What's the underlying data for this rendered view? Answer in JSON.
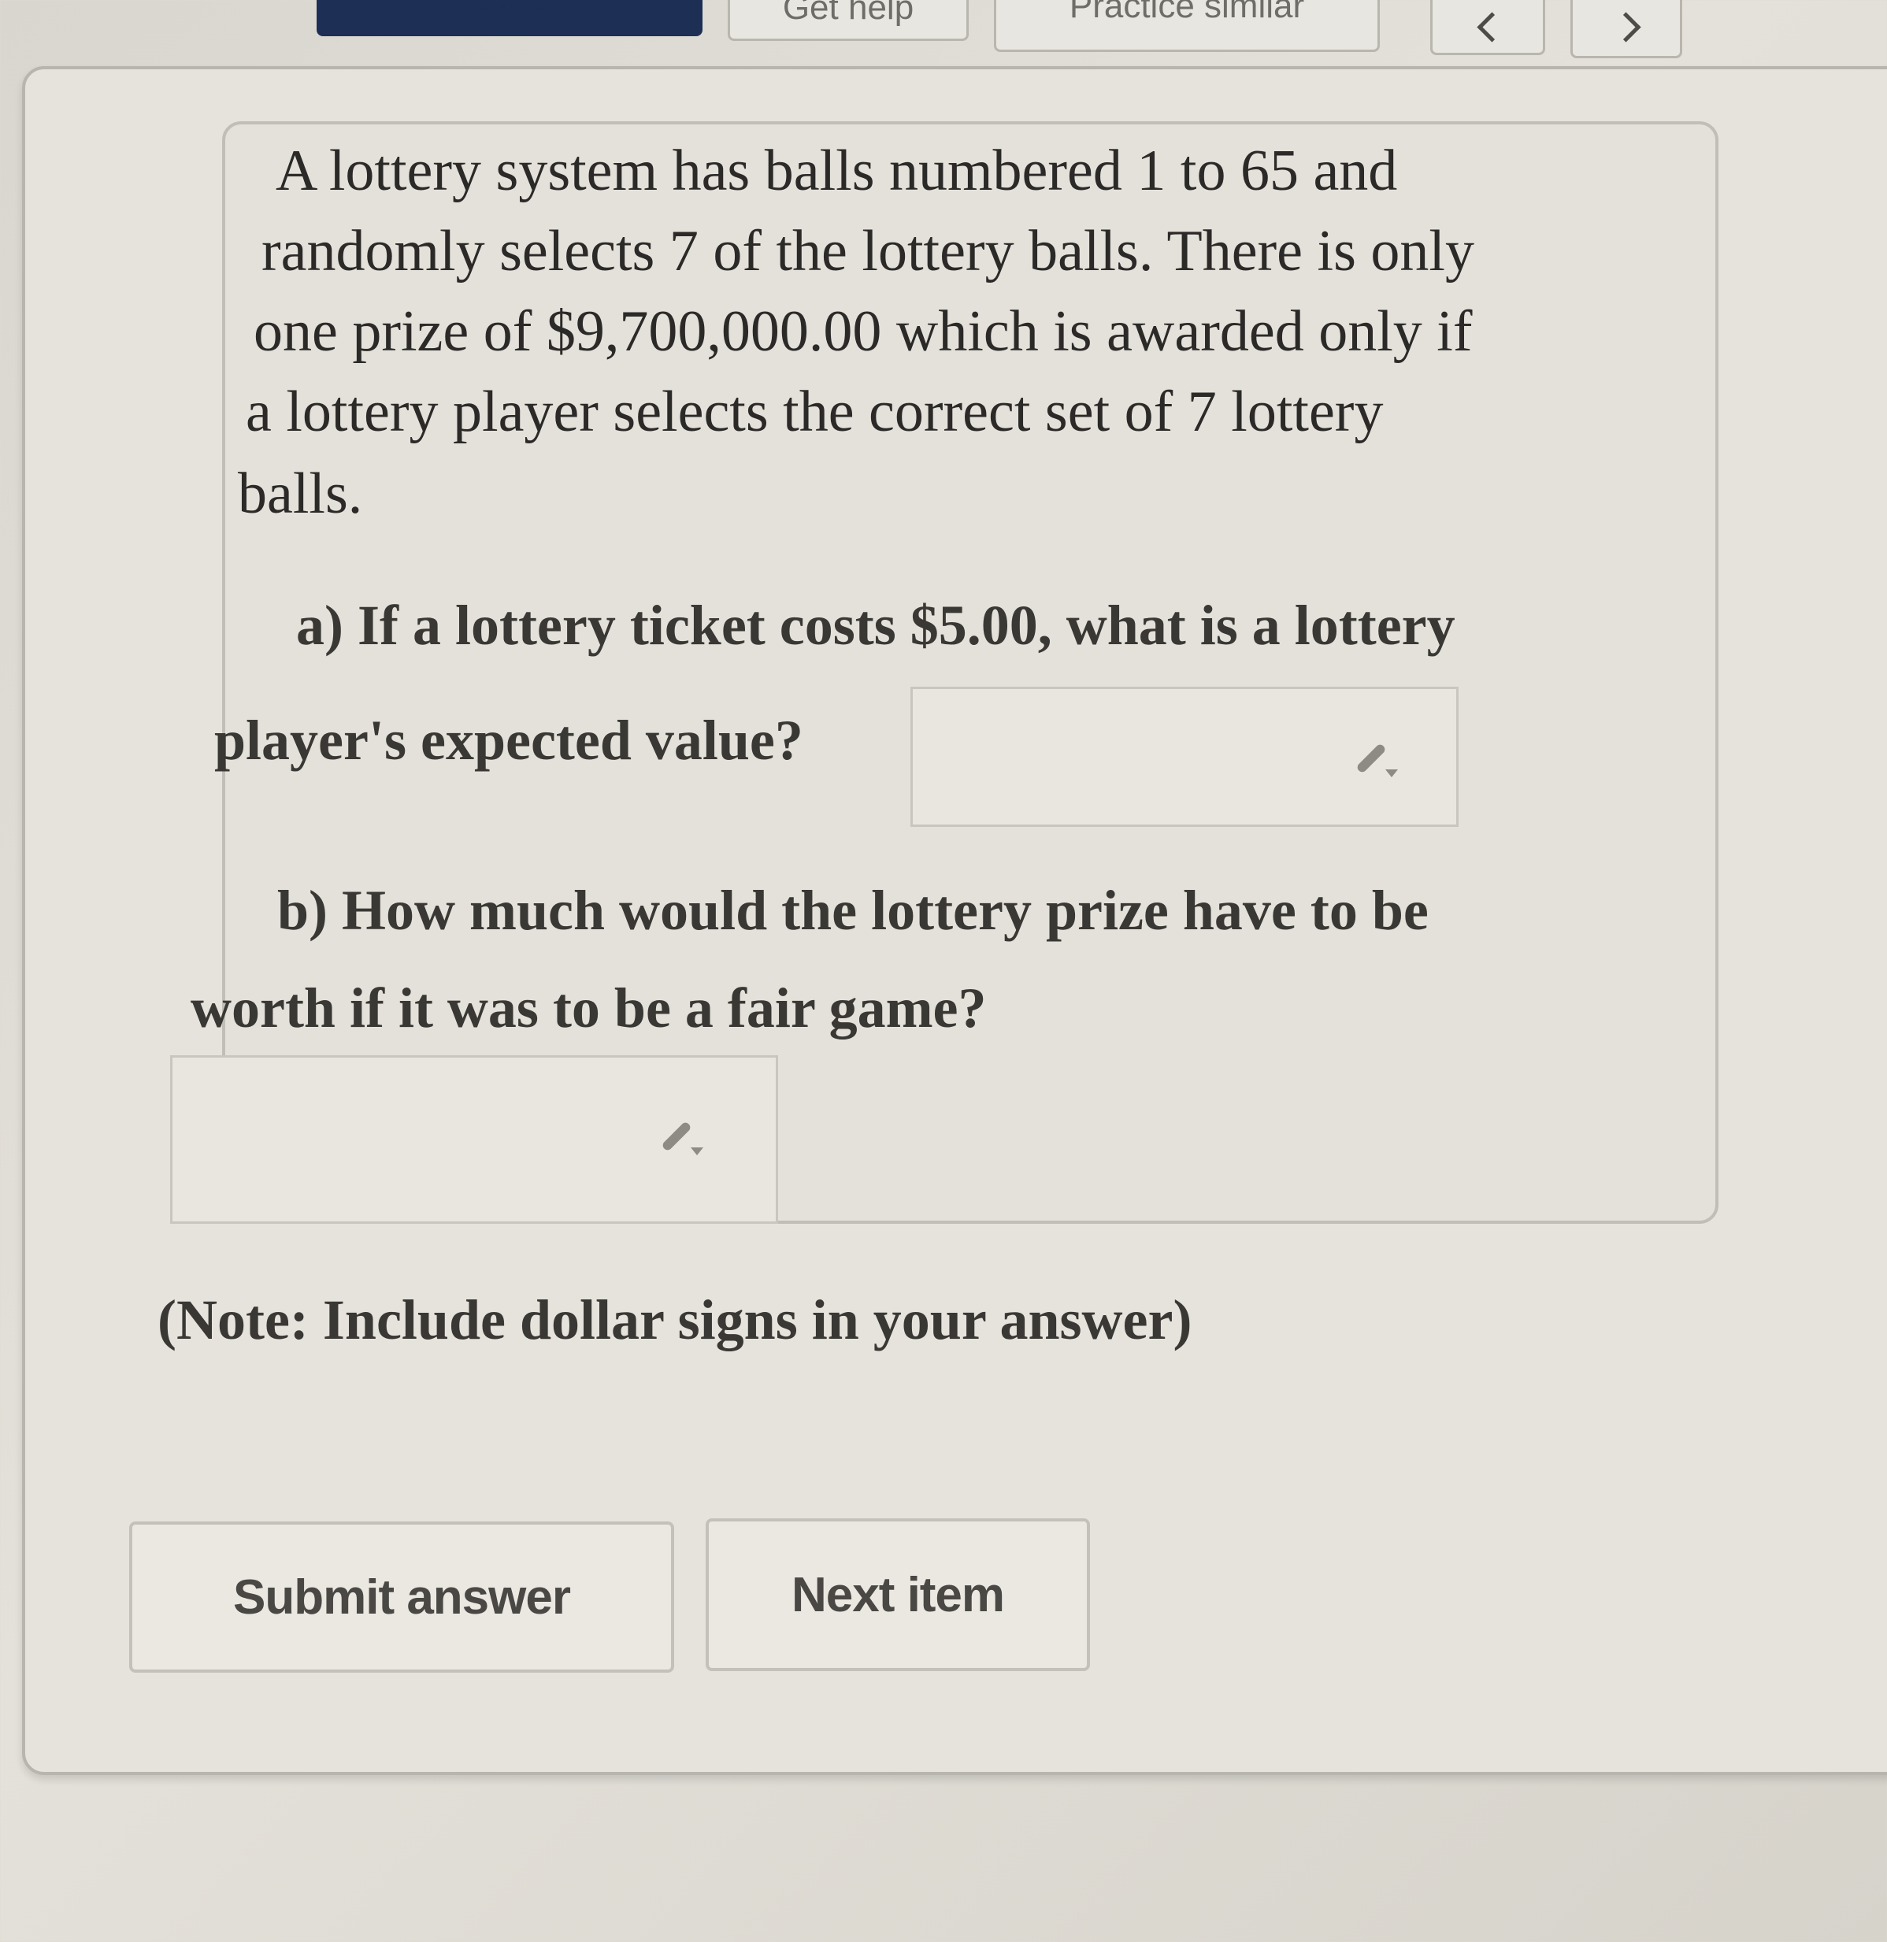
{
  "toolbar": {
    "submit_label": "Submit answer",
    "help_label": "Get help",
    "practice_label": "Practice similar",
    "prev_icon": "chevron-left-icon",
    "next_icon": "chevron-right-icon"
  },
  "question": {
    "lines": [
      "A lottery system has balls numbered 1 to 65 and",
      "randomly selects 7 of the lottery balls. There is only",
      "one prize of $9,700,000.00 which is awarded only if",
      "a lottery player selects the correct set of 7 lottery",
      "balls."
    ],
    "part_a": {
      "line1": "a) If a lottery ticket costs $5.00, what is a lottery",
      "line2": "player's expected value?",
      "answer_value": ""
    },
    "part_b": {
      "line1": "b) How much would the lottery prize have to be",
      "line2": "worth if it was to be a fair game?",
      "answer_value": ""
    },
    "note": "(Note: Include dollar signs in your answer)"
  },
  "actions": {
    "submit_label": "Submit answer",
    "next_label": "Next item"
  },
  "colors": {
    "primary_button": "#1d2f55",
    "background": "#e6e3dc",
    "text": "#2b2a28"
  }
}
